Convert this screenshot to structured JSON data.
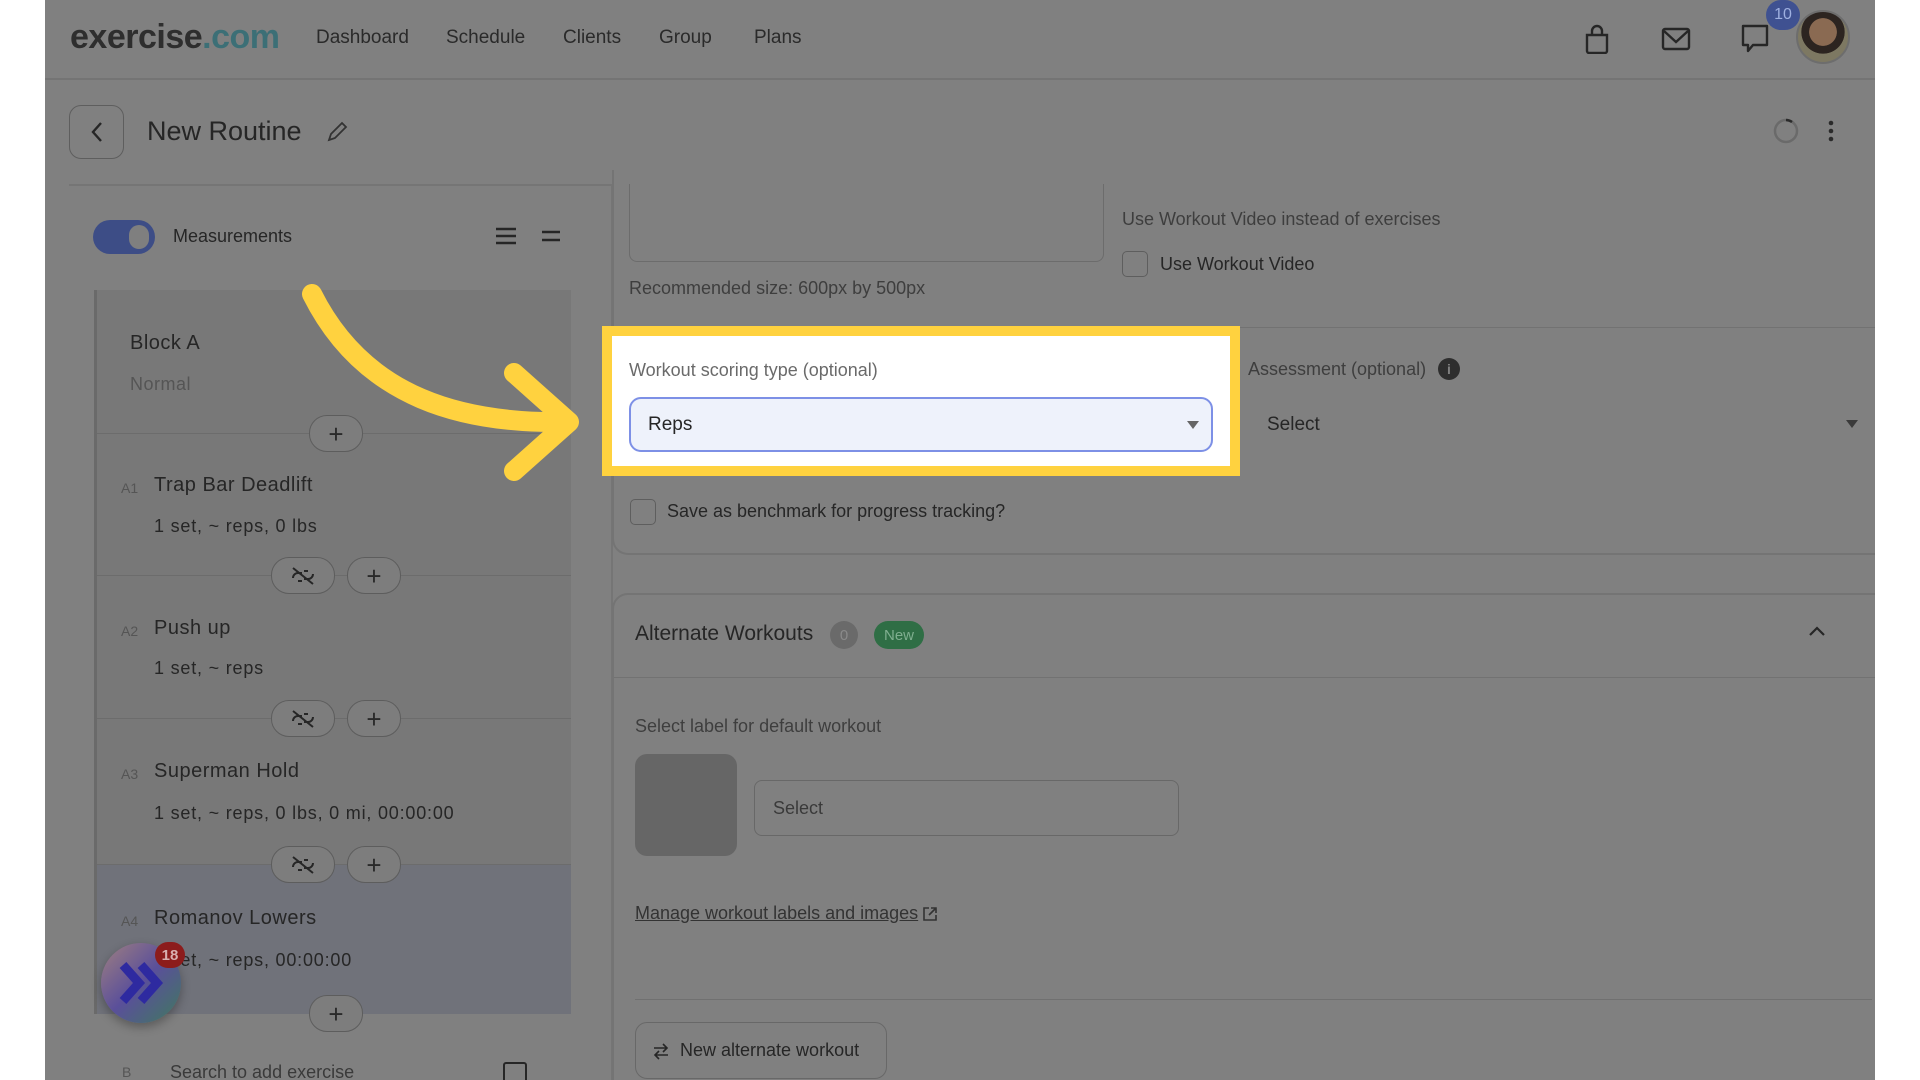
{
  "nav": {
    "logo_main": "exercise",
    "logo_tld": ".com",
    "links": [
      "Dashboard",
      "Schedule",
      "Clients",
      "Group",
      "Plans"
    ],
    "chat_badge": "10",
    "icons": [
      "shopping-bag-icon",
      "mail-icon",
      "chat-icon",
      "avatar"
    ]
  },
  "header": {
    "title": "New Routine"
  },
  "sidebar": {
    "toggle_label": "Measurements",
    "toggle_on": true,
    "block": {
      "title": "Block A",
      "type": "Normal"
    },
    "exercises": [
      {
        "index": "A1",
        "name": "Trap Bar Deadlift",
        "detail": "1 set, ~ reps, 0 lbs"
      },
      {
        "index": "A2",
        "name": "Push up",
        "detail": "1 set, ~ reps"
      },
      {
        "index": "A3",
        "name": "Superman Hold",
        "detail": "1 set, ~ reps, 0 lbs, 0 mi, 00:00:00"
      },
      {
        "index": "A4",
        "name": "Romanov Lowers",
        "detail": "1 set, ~ reps, 00:00:00"
      }
    ],
    "next_block_index": "B",
    "search_placeholder": "Search to add exercise",
    "floating_badge": "18"
  },
  "settings": {
    "image_hint": "Recommended size: 600px by 500px",
    "video_section_label": "Use Workout Video instead of exercises",
    "video_checkbox_label": "Use Workout Video",
    "video_checked": false,
    "scoring_label": "Workout scoring type (optional)",
    "scoring_value": "Reps",
    "assessment_label": "Assessment (optional)",
    "assessment_value": "Select",
    "benchmark_label": "Save as benchmark for progress tracking?",
    "benchmark_checked": false
  },
  "alternate": {
    "title": "Alternate Workouts",
    "count": "0",
    "new_badge": "New",
    "label_heading": "Select label for default workout",
    "label_select_placeholder": "Select",
    "manage_link": "Manage workout labels and images",
    "new_button": "New alternate workout"
  },
  "colors": {
    "highlight": "#ffd23f",
    "accent": "#3d4d86",
    "new_badge": "#2f6e45"
  }
}
